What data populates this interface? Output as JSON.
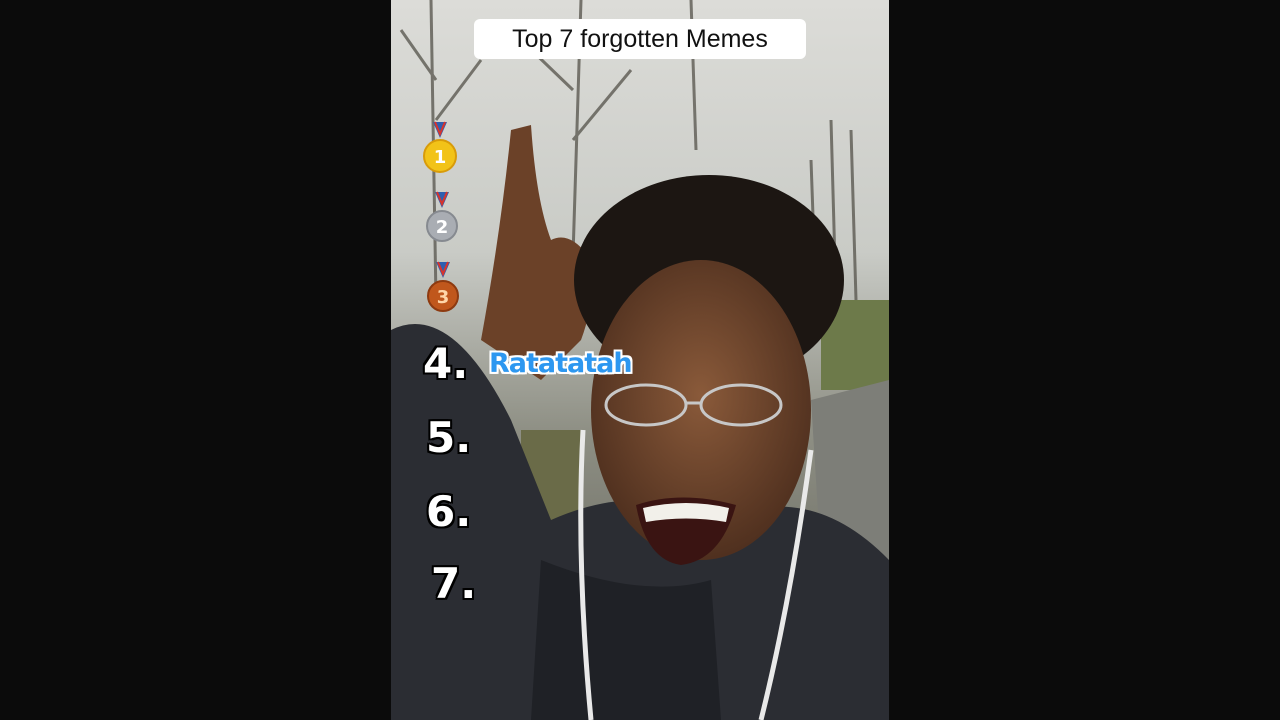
{
  "overlay": {
    "title": "Top 7 forgotten Memes",
    "medals": [
      {
        "number": "1",
        "color": "#f2c318",
        "icon": "gold-medal-icon"
      },
      {
        "number": "2",
        "color": "#a9adb3",
        "icon": "silver-medal-icon"
      },
      {
        "number": "3",
        "color": "#c0571c",
        "icon": "bronze-medal-icon"
      }
    ],
    "ranks": [
      "4.",
      "5.",
      "6.",
      "7."
    ],
    "entry_4": "Ratatatah",
    "entry_4_color": "#2d97f0"
  }
}
